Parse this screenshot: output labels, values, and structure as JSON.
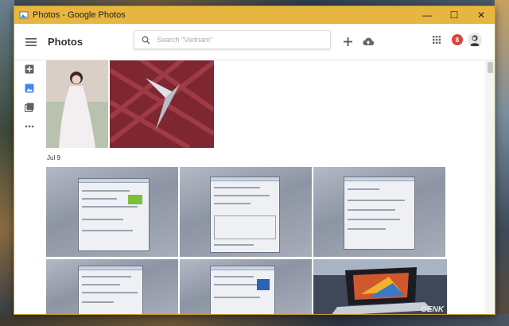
{
  "window": {
    "title": "Photos - Google Photos",
    "controls": {
      "minimize": "—",
      "maximize": "☐",
      "close": "✕"
    }
  },
  "appbar": {
    "brand": "Photos",
    "search_placeholder": "Search \"Vietnam\"",
    "notification_count": "8"
  },
  "sidebar": {
    "items": [
      "add-icon",
      "photos-icon",
      "albums-icon",
      "more-icon"
    ]
  },
  "content": {
    "section_date": "Jul 9"
  },
  "watermark": "GENK",
  "colors": {
    "titlebar": "#e6b640",
    "accent_blue": "#4285f4",
    "badge_red": "#db4437"
  }
}
